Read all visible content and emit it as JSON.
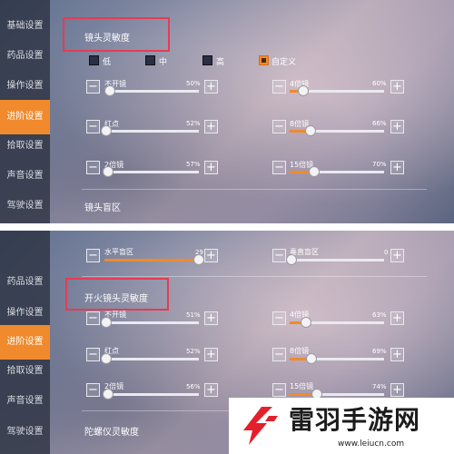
{
  "sidebar_top": [
    "基础设置",
    "药品设置",
    "操作设置",
    "进阶设置",
    "拾取设置",
    "声音设置",
    "驾驶设置"
  ],
  "sidebar_bottom": [
    "药品设置",
    "操作设置",
    "进阶设置",
    "拾取设置",
    "声音设置",
    "驾驶设置"
  ],
  "panel1": {
    "title": "镜头灵敏度",
    "presets": [
      "低",
      "中",
      "高",
      "自定义"
    ],
    "sliders": [
      {
        "label": "不开镜",
        "value": "50%"
      },
      {
        "label": "4倍镜",
        "value": "60%"
      },
      {
        "label": "红点",
        "value": "52%"
      },
      {
        "label": "8倍镜",
        "value": "66%"
      },
      {
        "label": "2倍镜",
        "value": "57%"
      },
      {
        "label": "15倍镜",
        "value": "70%"
      }
    ],
    "footer": "镜头盲区"
  },
  "panel2": {
    "deadzone": [
      {
        "label": "水平盲区",
        "value": "29"
      },
      {
        "label": "垂直盲区",
        "value": "0"
      }
    ],
    "title": "开火镜头灵敏度",
    "sliders": [
      {
        "label": "不开镜",
        "value": "51%"
      },
      {
        "label": "4倍镜",
        "value": "63%"
      },
      {
        "label": "红点",
        "value": "52%"
      },
      {
        "label": "8倍镜",
        "value": "69%"
      },
      {
        "label": "2倍镜",
        "value": "56%"
      },
      {
        "label": "15倍镜",
        "value": "74%"
      }
    ],
    "footer": "陀螺仪灵敏度"
  },
  "buttons": {
    "minus": "−",
    "plus": "+"
  },
  "watermark": {
    "brand": "雷羽手游网",
    "url": "www.leiucn.com"
  },
  "colors": {
    "accent": "#f08a2c",
    "highlight_box": "#e43c55"
  }
}
